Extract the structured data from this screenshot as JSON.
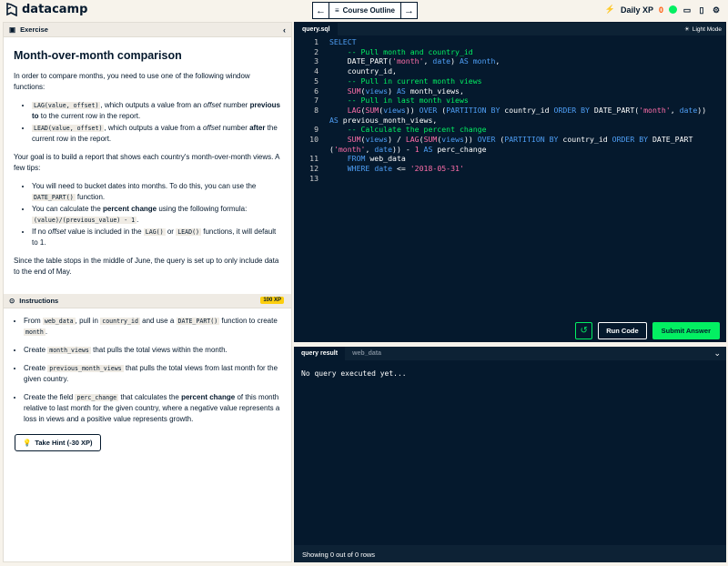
{
  "app": {
    "logo_text": "datacamp"
  },
  "nav": {
    "prev_icon": "←",
    "outline_label": "Course Outline",
    "next_icon": "→"
  },
  "top_right": {
    "xp_label": "Daily XP",
    "xp_value": "0"
  },
  "exercise": {
    "section_label": "Exercise",
    "title": "Month-over-month comparison",
    "intro_text": "In order to compare months, you need to use one of the following window functions:",
    "lag_code": "LAG(value, offset)",
    "lag_text_a": ", which outputs a value from an ",
    "lag_em": "offset",
    "lag_text_b": " number ",
    "lag_bold": "previous to",
    "lag_text_c": " to the current row in the report.",
    "lead_code": "LEAD(value, offset)",
    "lead_text_a": ", which outputs a value from a ",
    "lead_em": "offset",
    "lead_text_b": " number ",
    "lead_bold": "after",
    "lead_text_c": " the current row in the report.",
    "goal_text": "Your goal is to build a report that shows each country's month-over-month views. A few tips:",
    "tip1_text": "You will need to bucket dates into months. To do this, you can use the ",
    "tip1_code": "DATE_PART()",
    "tip1_end": " function.",
    "tip2_text": "You can calculate the ",
    "tip2_bold": "percent change",
    "tip2_text_b": " using the following formula: ",
    "tip2_code": "(value)/(previous_value) - 1",
    "tip2_end": ".",
    "tip3_text": "If no ",
    "tip3_em": "offset",
    "tip3_text_b": " value is included in the ",
    "tip3_code1": "LAG()",
    "tip3_or": " or ",
    "tip3_code2": "LEAD()",
    "tip3_end": " functions, it will default to 1.",
    "closing_text": "Since the table stops in the middle of June, the query is set up to only include data to the end of May."
  },
  "instructions": {
    "section_label": "Instructions",
    "xp_badge": "100 XP",
    "i1_a": "From ",
    "i1_code1": "web_data",
    "i1_b": ", pull in ",
    "i1_code2": "country_id",
    "i1_c": " and use a ",
    "i1_code3": "DATE_PART()",
    "i1_d": " function to create ",
    "i1_code4": "month",
    "i1_e": ".",
    "i2_a": "Create ",
    "i2_code": "month_views",
    "i2_b": " that pulls the total views within the month.",
    "i3_a": "Create ",
    "i3_code": "previous_month_views",
    "i3_b": " that pulls the total views from last month for the given country.",
    "i4_a": "Create the field ",
    "i4_code": "perc_change",
    "i4_b": " that calculates the ",
    "i4_bold": "percent change",
    "i4_c": " of this month relative to last month for the given country, where a negative value represents a loss in views and a positive value represents growth.",
    "hint_label": "Take Hint (-30 XP)"
  },
  "editor": {
    "tab_label": "query.sql",
    "light_mode_label": "Light Mode",
    "line_numbers": [
      "1",
      "2",
      "3",
      "4",
      "5",
      "6",
      "7",
      "8",
      "",
      "9",
      "10",
      "",
      "11",
      "12",
      "13"
    ],
    "run_label": "Run Code",
    "submit_label": "Submit Answer"
  },
  "results": {
    "tab1": "query result",
    "tab2": "web_data",
    "message": "No query executed yet...",
    "footer": "Showing 0 out of 0 rows"
  },
  "colors": {
    "accent_green": "#03ef62",
    "navy": "#05192d",
    "xp_orange": "#ff5400",
    "badge_yellow": "#fcce0d"
  }
}
